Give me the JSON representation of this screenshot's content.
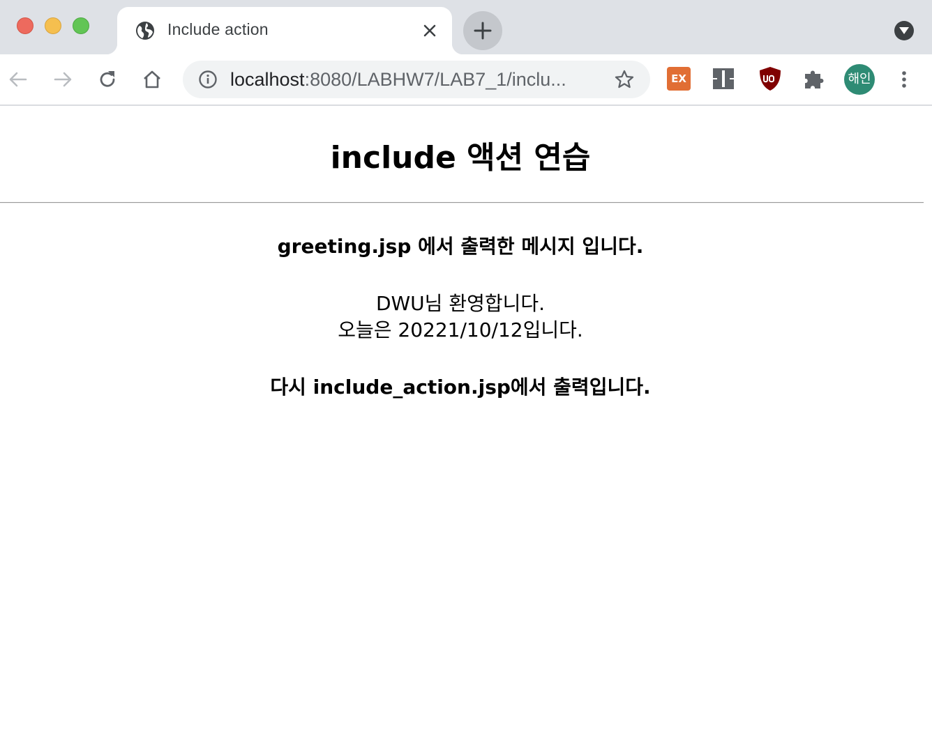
{
  "browser": {
    "tab": {
      "title": "Include action"
    },
    "address_bar": {
      "host": "localhost",
      "path": ":8080/LABHW7/LAB7_1/inclu..."
    },
    "extensions": {
      "ex_label": "EX",
      "profile_label": "해인"
    },
    "icons": [
      "globe-icon",
      "close-icon",
      "plus-icon",
      "tab-search-icon",
      "back-icon",
      "forward-icon",
      "reload-icon",
      "home-icon",
      "info-icon",
      "star-icon",
      "puzzle-icon",
      "kebab-menu-icon"
    ]
  },
  "page": {
    "title": "include 액션 연습",
    "greeting_header": "greeting.jsp 에서 출력한 메시지 입니다.",
    "welcome": "DWU님 환영합니다.",
    "today": "오늘은 20221/10/12입니다.",
    "footer": "다시 include_action.jsp에서 출력입니다."
  },
  "colors": {
    "tab_strip": "#dee1e6",
    "omnibox": "#f1f3f4",
    "ex_extension": "#e16e34",
    "ublock": "#800000",
    "avatar": "#2e8b74"
  }
}
